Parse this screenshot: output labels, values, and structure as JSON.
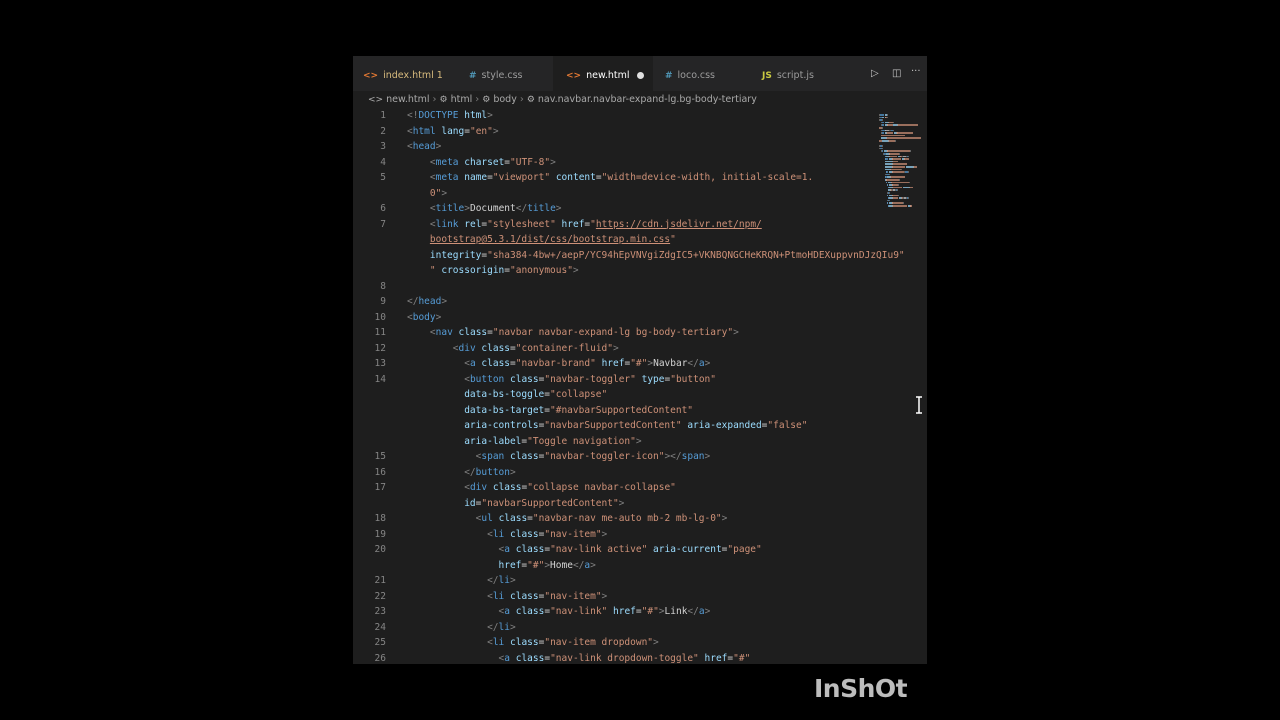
{
  "tabs": [
    {
      "label": "index.html",
      "badge": "1",
      "icon": "html-file-icon",
      "icon_glyph": "<>",
      "state": "modified"
    },
    {
      "label": "style.css",
      "icon": "css-file-icon",
      "icon_glyph": "#",
      "state": "normal"
    },
    {
      "label": "new.html",
      "icon": "html-file-icon",
      "icon_glyph": "<>",
      "state": "active",
      "dirty": true
    },
    {
      "label": "loco.css",
      "icon": "css-file-icon",
      "icon_glyph": "#",
      "state": "normal"
    },
    {
      "label": "script.js",
      "icon": "js-file-icon",
      "icon_glyph": "JS",
      "state": "normal"
    }
  ],
  "tab_actions": {
    "run_icon": "play-icon",
    "split_icon": "split-editor-icon",
    "more_icon": "more-icon",
    "run_glyph": "▷",
    "split_glyph": "◫",
    "more_glyph": "···"
  },
  "breadcrumb": {
    "items": [
      "new.html",
      "html",
      "body",
      "nav.navbar.navbar-expand-lg.bg-body-tertiary"
    ],
    "separator": "›"
  },
  "code_lines": [
    {
      "n": "1",
      "segs": [
        [
          "p",
          "<!"
        ],
        [
          "t",
          "DOCTYPE"
        ],
        [
          "x",
          " "
        ],
        [
          "a",
          "html"
        ],
        [
          "p",
          ">"
        ]
      ]
    },
    {
      "n": "2",
      "segs": [
        [
          "p",
          "<"
        ],
        [
          "t",
          "html"
        ],
        [
          "x",
          " "
        ],
        [
          "a",
          "lang"
        ],
        [
          "x",
          "="
        ],
        [
          "s",
          "\"en\""
        ],
        [
          "p",
          ">"
        ]
      ]
    },
    {
      "n": "3",
      "segs": [
        [
          "p",
          "<"
        ],
        [
          "t",
          "head"
        ],
        [
          "p",
          ">"
        ]
      ]
    },
    {
      "n": "4",
      "segs": [
        [
          "x",
          "    "
        ],
        [
          "p",
          "<"
        ],
        [
          "t",
          "meta"
        ],
        [
          "x",
          " "
        ],
        [
          "a",
          "charset"
        ],
        [
          "x",
          "="
        ],
        [
          "s",
          "\"UTF-8\""
        ],
        [
          "p",
          ">"
        ]
      ]
    },
    {
      "n": "5",
      "segs": [
        [
          "x",
          "    "
        ],
        [
          "p",
          "<"
        ],
        [
          "t",
          "meta"
        ],
        [
          "x",
          " "
        ],
        [
          "a",
          "name"
        ],
        [
          "x",
          "="
        ],
        [
          "s",
          "\"viewport\""
        ],
        [
          "x",
          " "
        ],
        [
          "a",
          "content"
        ],
        [
          "x",
          "="
        ],
        [
          "s",
          "\"width=device-width, initial-scale=1."
        ]
      ]
    },
    {
      "n": "",
      "segs": [
        [
          "s",
          "    0\""
        ],
        [
          "p",
          ">"
        ]
      ]
    },
    {
      "n": "6",
      "segs": [
        [
          "x",
          "    "
        ],
        [
          "p",
          "<"
        ],
        [
          "t",
          "title"
        ],
        [
          "p",
          ">"
        ],
        [
          "x",
          "Document"
        ],
        [
          "p",
          "</"
        ],
        [
          "t",
          "title"
        ],
        [
          "p",
          ">"
        ]
      ]
    },
    {
      "n": "7",
      "segs": [
        [
          "x",
          "    "
        ],
        [
          "p",
          "<"
        ],
        [
          "t",
          "link"
        ],
        [
          "x",
          " "
        ],
        [
          "a",
          "rel"
        ],
        [
          "x",
          "="
        ],
        [
          "s",
          "\"stylesheet\""
        ],
        [
          "x",
          " "
        ],
        [
          "a",
          "href"
        ],
        [
          "x",
          "="
        ],
        [
          "s",
          "\""
        ],
        [
          "u",
          "https://cdn.jsdelivr.net/npm/"
        ]
      ]
    },
    {
      "n": "",
      "segs": [
        [
          "x",
          "    "
        ],
        [
          "u",
          "bootstrap@5.3.1/dist/css/bootstrap.min.css"
        ],
        [
          "s",
          "\""
        ]
      ]
    },
    {
      "n": "",
      "segs": [
        [
          "x",
          "    "
        ],
        [
          "a",
          "integrity"
        ],
        [
          "x",
          "="
        ],
        [
          "s",
          "\"sha384-4bw+/aepP/YC94hEpVNVgiZdgIC5+VKNBQNGCHeKRQN+PtmoHDEXuppvnDJzQIu9\""
        ]
      ]
    },
    {
      "n": "",
      "segs": [
        [
          "s",
          "    \""
        ],
        [
          "x",
          " "
        ],
        [
          "a",
          "crossorigin"
        ],
        [
          "x",
          "="
        ],
        [
          "s",
          "\"anonymous\""
        ],
        [
          "p",
          ">"
        ]
      ]
    },
    {
      "n": "8",
      "segs": []
    },
    {
      "n": "9",
      "segs": [
        [
          "p",
          "</"
        ],
        [
          "t",
          "head"
        ],
        [
          "p",
          ">"
        ]
      ]
    },
    {
      "n": "10",
      "segs": [
        [
          "p",
          "<"
        ],
        [
          "t",
          "body"
        ],
        [
          "p",
          ">"
        ]
      ]
    },
    {
      "n": "11",
      "segs": [
        [
          "x",
          "    "
        ],
        [
          "p",
          "<"
        ],
        [
          "t",
          "nav"
        ],
        [
          "x",
          " "
        ],
        [
          "a",
          "class"
        ],
        [
          "x",
          "="
        ],
        [
          "s",
          "\"navbar navbar-expand-lg bg-body-tertiary\""
        ],
        [
          "p",
          ">"
        ]
      ]
    },
    {
      "n": "12",
      "segs": [
        [
          "x",
          "        "
        ],
        [
          "p",
          "<"
        ],
        [
          "t",
          "div"
        ],
        [
          "x",
          " "
        ],
        [
          "a",
          "class"
        ],
        [
          "x",
          "="
        ],
        [
          "s",
          "\"container-fluid\""
        ],
        [
          "p",
          ">"
        ]
      ]
    },
    {
      "n": "13",
      "segs": [
        [
          "x",
          "          "
        ],
        [
          "p",
          "<"
        ],
        [
          "t",
          "a"
        ],
        [
          "x",
          " "
        ],
        [
          "a",
          "class"
        ],
        [
          "x",
          "="
        ],
        [
          "s",
          "\"navbar-brand\""
        ],
        [
          "x",
          " "
        ],
        [
          "a",
          "href"
        ],
        [
          "x",
          "="
        ],
        [
          "s",
          "\"#\""
        ],
        [
          "p",
          ">"
        ],
        [
          "x",
          "Navbar"
        ],
        [
          "p",
          "</"
        ],
        [
          "t",
          "a"
        ],
        [
          "p",
          ">"
        ]
      ]
    },
    {
      "n": "14",
      "segs": [
        [
          "x",
          "          "
        ],
        [
          "p",
          "<"
        ],
        [
          "t",
          "button"
        ],
        [
          "x",
          " "
        ],
        [
          "a",
          "class"
        ],
        [
          "x",
          "="
        ],
        [
          "s",
          "\"navbar-toggler\""
        ],
        [
          "x",
          " "
        ],
        [
          "a",
          "type"
        ],
        [
          "x",
          "="
        ],
        [
          "s",
          "\"button\""
        ]
      ]
    },
    {
      "n": "",
      "segs": [
        [
          "x",
          "          "
        ],
        [
          "a",
          "data-bs-toggle"
        ],
        [
          "x",
          "="
        ],
        [
          "s",
          "\"collapse\""
        ]
      ]
    },
    {
      "n": "",
      "segs": [
        [
          "x",
          "          "
        ],
        [
          "a",
          "data-bs-target"
        ],
        [
          "x",
          "="
        ],
        [
          "s",
          "\"#navbarSupportedContent\""
        ]
      ]
    },
    {
      "n": "",
      "segs": [
        [
          "x",
          "          "
        ],
        [
          "a",
          "aria-controls"
        ],
        [
          "x",
          "="
        ],
        [
          "s",
          "\"navbarSupportedContent\""
        ],
        [
          "x",
          " "
        ],
        [
          "a",
          "aria-expanded"
        ],
        [
          "x",
          "="
        ],
        [
          "s",
          "\"false\""
        ]
      ]
    },
    {
      "n": "",
      "segs": [
        [
          "x",
          "          "
        ],
        [
          "a",
          "aria-label"
        ],
        [
          "x",
          "="
        ],
        [
          "s",
          "\"Toggle navigation\""
        ],
        [
          "p",
          ">"
        ]
      ]
    },
    {
      "n": "15",
      "segs": [
        [
          "x",
          "            "
        ],
        [
          "p",
          "<"
        ],
        [
          "t",
          "span"
        ],
        [
          "x",
          " "
        ],
        [
          "a",
          "class"
        ],
        [
          "x",
          "="
        ],
        [
          "s",
          "\"navbar-toggler-icon\""
        ],
        [
          "p",
          "></"
        ],
        [
          "t",
          "span"
        ],
        [
          "p",
          ">"
        ]
      ]
    },
    {
      "n": "16",
      "segs": [
        [
          "x",
          "          "
        ],
        [
          "p",
          "</"
        ],
        [
          "t",
          "button"
        ],
        [
          "p",
          ">"
        ]
      ]
    },
    {
      "n": "17",
      "segs": [
        [
          "x",
          "          "
        ],
        [
          "p",
          "<"
        ],
        [
          "t",
          "div"
        ],
        [
          "x",
          " "
        ],
        [
          "a",
          "class"
        ],
        [
          "x",
          "="
        ],
        [
          "s",
          "\"collapse navbar-collapse\""
        ]
      ]
    },
    {
      "n": "",
      "segs": [
        [
          "x",
          "          "
        ],
        [
          "a",
          "id"
        ],
        [
          "x",
          "="
        ],
        [
          "s",
          "\"navbarSupportedContent\""
        ],
        [
          "p",
          ">"
        ]
      ]
    },
    {
      "n": "18",
      "segs": [
        [
          "x",
          "            "
        ],
        [
          "p",
          "<"
        ],
        [
          "t",
          "ul"
        ],
        [
          "x",
          " "
        ],
        [
          "a",
          "class"
        ],
        [
          "x",
          "="
        ],
        [
          "s",
          "\"navbar-nav me-auto mb-2 mb-lg-0\""
        ],
        [
          "p",
          ">"
        ]
      ]
    },
    {
      "n": "19",
      "segs": [
        [
          "x",
          "              "
        ],
        [
          "p",
          "<"
        ],
        [
          "t",
          "li"
        ],
        [
          "x",
          " "
        ],
        [
          "a",
          "class"
        ],
        [
          "x",
          "="
        ],
        [
          "s",
          "\"nav-item\""
        ],
        [
          "p",
          ">"
        ]
      ]
    },
    {
      "n": "20",
      "segs": [
        [
          "x",
          "                "
        ],
        [
          "p",
          "<"
        ],
        [
          "t",
          "a"
        ],
        [
          "x",
          " "
        ],
        [
          "a",
          "class"
        ],
        [
          "x",
          "="
        ],
        [
          "s",
          "\"nav-link active\""
        ],
        [
          "x",
          " "
        ],
        [
          "a",
          "aria-current"
        ],
        [
          "x",
          "="
        ],
        [
          "s",
          "\"page\""
        ]
      ]
    },
    {
      "n": "",
      "segs": [
        [
          "x",
          "                "
        ],
        [
          "a",
          "href"
        ],
        [
          "x",
          "="
        ],
        [
          "s",
          "\"#\""
        ],
        [
          "p",
          ">"
        ],
        [
          "x",
          "Home"
        ],
        [
          "p",
          "</"
        ],
        [
          "t",
          "a"
        ],
        [
          "p",
          ">"
        ]
      ]
    },
    {
      "n": "21",
      "segs": [
        [
          "x",
          "              "
        ],
        [
          "p",
          "</"
        ],
        [
          "t",
          "li"
        ],
        [
          "p",
          ">"
        ]
      ]
    },
    {
      "n": "22",
      "segs": [
        [
          "x",
          "              "
        ],
        [
          "p",
          "<"
        ],
        [
          "t",
          "li"
        ],
        [
          "x",
          " "
        ],
        [
          "a",
          "class"
        ],
        [
          "x",
          "="
        ],
        [
          "s",
          "\"nav-item\""
        ],
        [
          "p",
          ">"
        ]
      ]
    },
    {
      "n": "23",
      "segs": [
        [
          "x",
          "                "
        ],
        [
          "p",
          "<"
        ],
        [
          "t",
          "a"
        ],
        [
          "x",
          " "
        ],
        [
          "a",
          "class"
        ],
        [
          "x",
          "="
        ],
        [
          "s",
          "\"nav-link\""
        ],
        [
          "x",
          " "
        ],
        [
          "a",
          "href"
        ],
        [
          "x",
          "="
        ],
        [
          "s",
          "\"#\""
        ],
        [
          "p",
          ">"
        ],
        [
          "x",
          "Link"
        ],
        [
          "p",
          "</"
        ],
        [
          "t",
          "a"
        ],
        [
          "p",
          ">"
        ]
      ]
    },
    {
      "n": "24",
      "segs": [
        [
          "x",
          "              "
        ],
        [
          "p",
          "</"
        ],
        [
          "t",
          "li"
        ],
        [
          "p",
          ">"
        ]
      ]
    },
    {
      "n": "25",
      "segs": [
        [
          "x",
          "              "
        ],
        [
          "p",
          "<"
        ],
        [
          "t",
          "li"
        ],
        [
          "x",
          " "
        ],
        [
          "a",
          "class"
        ],
        [
          "x",
          "="
        ],
        [
          "s",
          "\"nav-item dropdown\""
        ],
        [
          "p",
          ">"
        ]
      ]
    },
    {
      "n": "26",
      "segs": [
        [
          "x",
          "                "
        ],
        [
          "p",
          "<"
        ],
        [
          "t",
          "a"
        ],
        [
          "x",
          " "
        ],
        [
          "a",
          "class"
        ],
        [
          "x",
          "="
        ],
        [
          "s",
          "\"nav-link dropdown-toggle\""
        ],
        [
          "x",
          " "
        ],
        [
          "a",
          "href"
        ],
        [
          "x",
          "="
        ],
        [
          "s",
          "\"#\""
        ]
      ]
    }
  ],
  "colors": {
    "editor_bg": "#1e1e1e",
    "tabbar_bg": "#252526",
    "tag": "#569cd6",
    "attr": "#9cdcfe",
    "string": "#ce9178",
    "punct": "#808080",
    "text": "#d4d4d4"
  },
  "mouse_cursor": "text-cursor-icon",
  "watermark": "InShOt"
}
